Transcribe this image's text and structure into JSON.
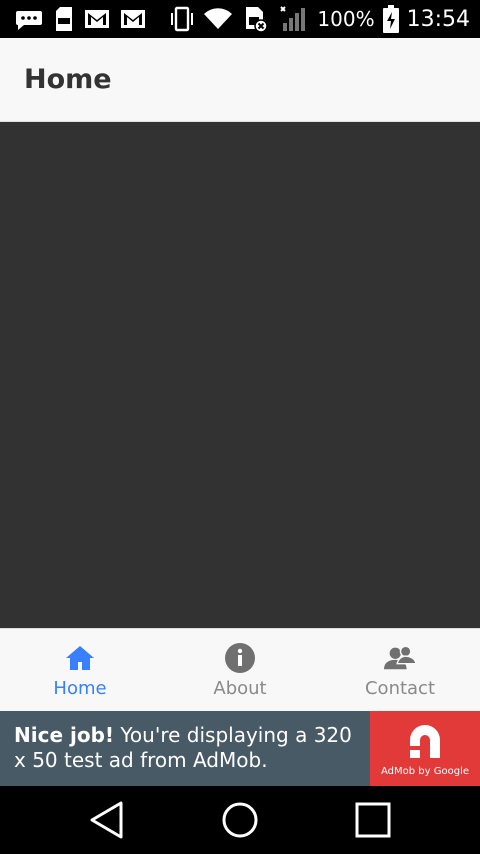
{
  "status_bar": {
    "battery_percent": "100%",
    "time": "13:54",
    "icons": [
      "chat-icon",
      "sd-card-icon",
      "gmail-icon",
      "gmail-icon",
      "vibrate-icon",
      "wifi-icon",
      "sim-off-icon",
      "signal-icon",
      "battery-charging-icon"
    ]
  },
  "app_bar": {
    "title": "Home"
  },
  "tabs": [
    {
      "label": "Home",
      "icon": "home-icon",
      "active": true
    },
    {
      "label": "About",
      "icon": "info-icon",
      "active": false
    },
    {
      "label": "Contact",
      "icon": "contacts-icon",
      "active": false
    }
  ],
  "ad": {
    "headline": "Nice job!",
    "body": " You're displaying a 320 x 50 test ad from AdMob.",
    "logo_caption": "AdMob by Google"
  },
  "colors": {
    "accent": "#3880ff",
    "content_bg": "#323232",
    "ad_bg": "#485a66",
    "admob_red": "#e13a38"
  }
}
